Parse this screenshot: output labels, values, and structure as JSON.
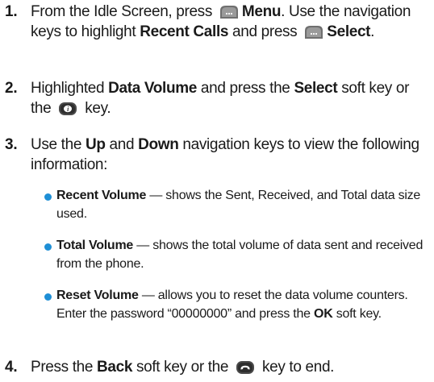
{
  "icons": {
    "menu_key": "menu-softkey-icon",
    "info_key": "info-key-icon",
    "end_key": "end-key-icon"
  },
  "steps": [
    {
      "number": "1.",
      "t1": "From the Idle Screen, press",
      "b1": "Menu",
      "t2": ". Use the navigation keys to highlight",
      "b2": "Recent Calls",
      "t3": "and press",
      "b3": "Select",
      "t4": "."
    },
    {
      "number": "2.",
      "t1": "Highlighted",
      "b1": "Data Volume",
      "t2": "and press the",
      "b2": "Select",
      "t3": "soft key or the",
      "t4": "key."
    },
    {
      "number": "3.",
      "t1": "Use the",
      "b1": "Up",
      "t2": "and",
      "b2": "Down",
      "t3": "navigation keys to view the following information:"
    },
    {
      "number": "4.",
      "t1": "Press the",
      "b1": "Back",
      "t2": "soft key or the",
      "t3": "key to end."
    }
  ],
  "bullets": [
    {
      "title": "Recent Volume",
      "text": "— shows the Sent, Received, and Total data size used."
    },
    {
      "title": "Total Volume",
      "text": "— shows the total volume of data sent and received from the phone."
    },
    {
      "title": "Reset Volume",
      "text": "— allows you to reset the data volume counters. Enter the password “00000000” and press the",
      "bold_end": "OK",
      "text_end": "soft key."
    }
  ]
}
